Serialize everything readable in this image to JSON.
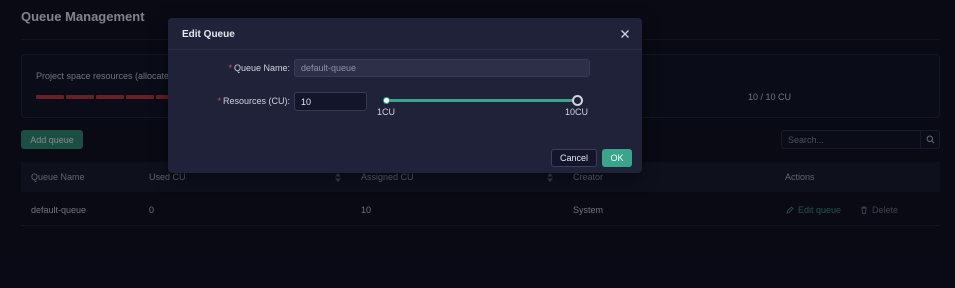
{
  "page": {
    "title": "Queue Management"
  },
  "resources": {
    "label": "Project space resources (allocated",
    "value": "10 / 10 CU",
    "bar_color": "#b8353b"
  },
  "toolbar": {
    "add_label": "Add queue",
    "search_placeholder": "Search...",
    "search_icon": "search-icon"
  },
  "table": {
    "columns": [
      "Queue Name",
      "Used CU",
      "Assigned CU",
      "Creator",
      "Actions"
    ],
    "rows": [
      {
        "name": "default-queue",
        "used": "0",
        "assigned": "10",
        "creator": "System",
        "edit": "Edit queue",
        "delete": "Delete"
      }
    ]
  },
  "modal": {
    "title": "Edit Queue",
    "name_label": "Queue Name",
    "name_value": "default-queue",
    "resources_label": "Resources (CU)",
    "resources_value": "10",
    "slider_min": "1CU",
    "slider_max": "10CU",
    "slider_level": 1.0,
    "cancel_label": "Cancel",
    "ok_label": "OK",
    "accent": "#3aa58a"
  }
}
